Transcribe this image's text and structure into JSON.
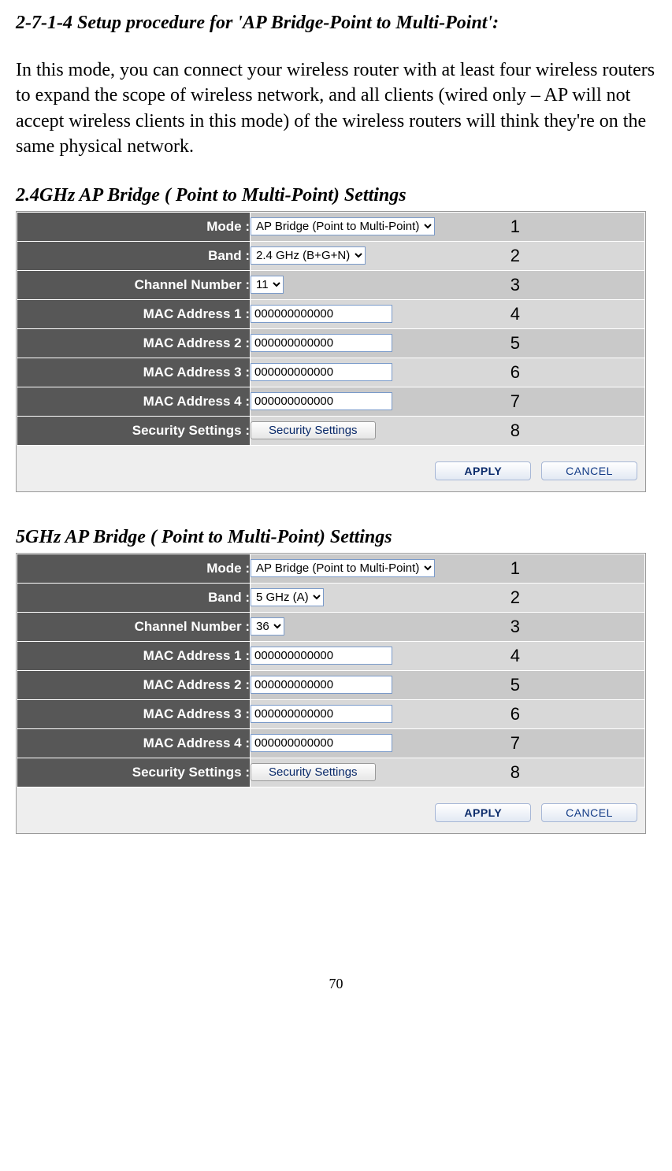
{
  "title": "2-7-1-4 Setup procedure for 'AP Bridge-Point to Multi-Point':",
  "paragraph": "In this mode, you can connect your wireless router with at least four wireless routers to expand the scope of wireless network, and all clients (wired only – AP will not accept wireless clients in this mode) of the wireless routers will think they're on the same physical network.",
  "section_24": {
    "heading": "2.4GHz AP Bridge ( Point to Multi-Point) Settings",
    "rows": [
      {
        "label": "Mode :",
        "type": "select",
        "value": "AP Bridge (Point to Multi-Point)",
        "annot": "1"
      },
      {
        "label": "Band :",
        "type": "select",
        "value": "2.4 GHz (B+G+N)",
        "annot": "2"
      },
      {
        "label": "Channel Number :",
        "type": "select",
        "value": "11",
        "annot": "3"
      },
      {
        "label": "MAC Address 1 :",
        "type": "text",
        "value": "000000000000",
        "annot": "4"
      },
      {
        "label": "MAC Address 2 :",
        "type": "text",
        "value": "000000000000",
        "annot": "5"
      },
      {
        "label": "MAC Address 3 :",
        "type": "text",
        "value": "000000000000",
        "annot": "6"
      },
      {
        "label": "MAC Address 4 :",
        "type": "text",
        "value": "000000000000",
        "annot": "7"
      },
      {
        "label": "Security Settings :",
        "type": "button",
        "value": "Security Settings",
        "annot": "8"
      }
    ]
  },
  "section_5": {
    "heading": "5GHz AP Bridge ( Point to Multi-Point) Settings",
    "rows": [
      {
        "label": "Mode :",
        "type": "select",
        "value": "AP Bridge (Point to Multi-Point)",
        "annot": "1"
      },
      {
        "label": "Band :",
        "type": "select",
        "value": "5 GHz (A)",
        "annot": "2"
      },
      {
        "label": "Channel Number :",
        "type": "select",
        "value": "36",
        "annot": "3"
      },
      {
        "label": "MAC Address 1 :",
        "type": "text",
        "value": "000000000000",
        "annot": "4"
      },
      {
        "label": "MAC Address 2 :",
        "type": "text",
        "value": "000000000000",
        "annot": "5"
      },
      {
        "label": "MAC Address 3 :",
        "type": "text",
        "value": "000000000000",
        "annot": "6"
      },
      {
        "label": "MAC Address 4 :",
        "type": "text",
        "value": "000000000000",
        "annot": "7"
      },
      {
        "label": "Security Settings :",
        "type": "button",
        "value": "Security Settings",
        "annot": "8"
      }
    ]
  },
  "buttons": {
    "apply": "APPLY",
    "cancel": "CANCEL"
  },
  "page_number": "70"
}
